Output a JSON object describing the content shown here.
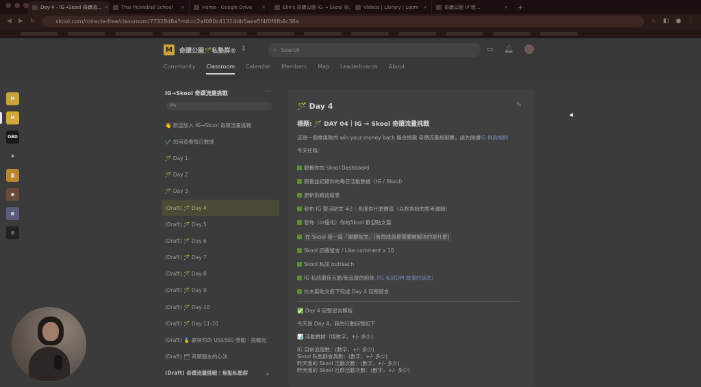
{
  "browser": {
    "tabs": [
      {
        "title": "Day 4 - IG→Skool 奇蹟流..."
      },
      {
        "title": "Thai Pickleball School"
      },
      {
        "title": "Home - Google Drive"
      },
      {
        "title": "Elin's 奇蹟公園 IG → Skool 奇..."
      },
      {
        "title": "Videos | Library | Loom"
      },
      {
        "title": "奇蹟公園 IP 營..."
      }
    ],
    "url": "skool.com/miracle-free/classroom/77328d8a?md=c2af080c41314db5aee5f4f0f6fb6c38a",
    "new_tab": "+"
  },
  "header": {
    "group_name": "奇蹟公園🪄私塾群®",
    "search_placeholder": "Search",
    "nav": [
      "Community",
      "Classroom",
      "Calendar",
      "Members",
      "Map",
      "Leaderboards",
      "About"
    ]
  },
  "rail": [
    {
      "label": "M",
      "color": "#c8a23a"
    },
    {
      "label": "M",
      "color": "#d4a93a"
    },
    {
      "label": "OBD",
      "color": "#1a1a1a"
    },
    {
      "label": "≡",
      "color": "#3a3a3a"
    },
    {
      "label": "富",
      "color": "#b8862c"
    },
    {
      "label": "▣",
      "color": "#6a4a3a"
    },
    {
      "label": "▦",
      "color": "#5a5a7a"
    },
    {
      "label": "◎",
      "color": "#222"
    }
  ],
  "course": {
    "title": "IG→Skool 奇蹟流量挑戰",
    "progress": "0%",
    "lessons": [
      "👋 歡迎加入 IG→Skool 奇蹟流量挑戰",
      "✔️ 如何查看每日數據",
      "🪄 Day 1",
      "🪄 Day 2",
      "🪄 Day 3",
      "(Draft) 🪄 Day 4",
      "(Draft) 🪄 Day 5",
      "(Draft) 🪄 Day 6",
      "(Draft) 🪄 Day 7",
      "(Draft) 🪄 Day 8",
      "(Draft) 🪄 Day 9",
      "(Draft) 🪄 Day 10",
      "(Draft) 🪄 Day 11-30",
      "(Draft) 🏅 贏得你的 US$500 獎勵｜挑戰完",
      "(Draft) 🗂 奇蹟園友的心法",
      "(Draft) 奇蹟流量挑戰｜焦點私塾群"
    ]
  },
  "content": {
    "lesson_title": "🪄 Day 4",
    "heading": "標題: 🪄 DAY 04｜IG → Skool 奇蹟流量挑戰",
    "intro": "這是一個零風險的 win your money back 獎金挑戰 奇蹟流量挑戰賽，請先閱讀",
    "intro_link": "IG 挑戰規則",
    "today_tasks": "今天任務：",
    "tasks": [
      {
        "text": "觀看你的 Skool Dashboard"
      },
      {
        "text": "觀看並記錄你的每日活動數據（IG / Skool）"
      },
      {
        "text": "更新挑戰追蹤表"
      },
      {
        "text": "發布 IG 靈活貼文 #2｜長提供什麼價值（以終為始的思考邏輯）"
      },
      {
        "text": "發佈（or優化）你的Skool 歡迎貼文篇"
      },
      {
        "text": "在 Skool 發一篇「關鍵貼文」(會問成員最需要被解決的是什麼)",
        "highlight": true
      },
      {
        "text": "Skool 回覆留言 / Like comment x 10"
      },
      {
        "text": "Skool 私訊 outreach"
      },
      {
        "text": "IG 私訊最佳互動/新追蹤的粉絲",
        "link": "(IG 私訊DM 故事的版本)"
      },
      {
        "text": "在本篇貼文底下完成 Day 4 回報留言"
      }
    ],
    "report_title": "✅ Day 4 回報留言模板",
    "report_intro": "今天是 Day 4，我的行動回報如下",
    "activity_label": "📊 活動數據（填數字，+/- 多少)",
    "activity_lines": [
      "IG 目前追蹤數：(數字，+/- 多少)",
      "Skool 私塾群會員數：(數字，+/- 多少)",
      "昨天我的 Skool 活動次數：(數字，+/- 多少)",
      "昨天我的 Skool 社群活動次數：(數字，+/- 多少)"
    ]
  }
}
